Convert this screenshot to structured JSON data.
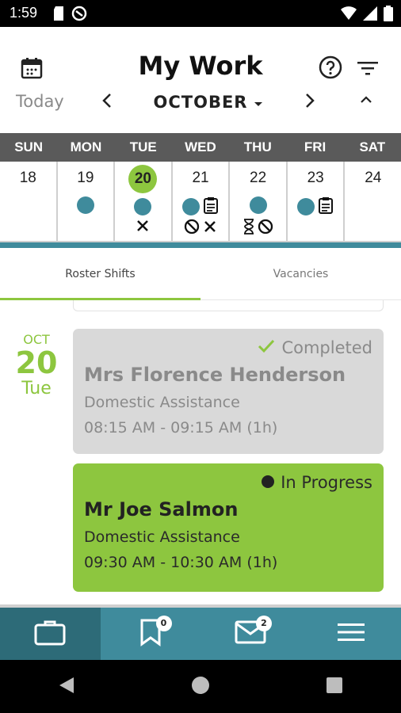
{
  "status_bar": {
    "time": "1:59"
  },
  "header": {
    "title": "My Work",
    "today_label": "Today",
    "month_label": "OCTOBER"
  },
  "week": {
    "day_names": [
      "SUN",
      "MON",
      "TUE",
      "WED",
      "THU",
      "FRI",
      "SAT"
    ],
    "days": [
      {
        "num": "18",
        "selected": false,
        "icons": []
      },
      {
        "num": "19",
        "selected": false,
        "icons": [
          "dot"
        ]
      },
      {
        "num": "20",
        "selected": true,
        "icons": [
          "dot",
          "cross"
        ]
      },
      {
        "num": "21",
        "selected": false,
        "icons": [
          "dot",
          "notes",
          "ban",
          "cross"
        ]
      },
      {
        "num": "22",
        "selected": false,
        "icons": [
          "dot",
          "hourglass",
          "ban"
        ]
      },
      {
        "num": "23",
        "selected": false,
        "icons": [
          "dot",
          "notes"
        ]
      },
      {
        "num": "24",
        "selected": false,
        "icons": []
      }
    ]
  },
  "tabs": {
    "roster": "Roster Shifts",
    "vacancies": "Vacancies"
  },
  "date_block": {
    "month": "OCT",
    "day": "20",
    "weekday": "Tue"
  },
  "shifts": [
    {
      "status": "Completed",
      "name": "Mrs Florence Henderson",
      "service": "Domestic Assistance",
      "time": "08:15 AM - 09:15 AM (1h)"
    },
    {
      "status": "In Progress",
      "name": "Mr Joe Salmon",
      "service": "Domestic Assistance",
      "time": "09:30 AM - 10:30 AM (1h)"
    }
  ],
  "bottom_nav": {
    "bookmark_badge": "0",
    "mail_badge": "2"
  },
  "colors": {
    "accent_green": "#8dc63f",
    "teal": "#3f8b9c",
    "teal_dark": "#2d6b78",
    "header_gray": "#5a5a5a"
  }
}
